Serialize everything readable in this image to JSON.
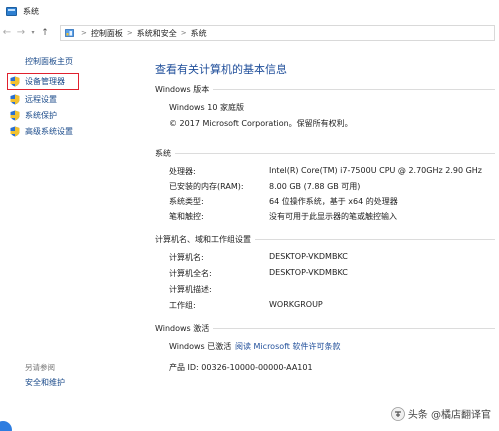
{
  "window": {
    "title": "系统"
  },
  "nav": {
    "back": "←",
    "forward": "→",
    "dropdown": "▾",
    "up": "↑",
    "breadcrumb": [
      "控制面板",
      "系统和安全",
      "系统"
    ],
    "separator": ">"
  },
  "sidebar": {
    "home": "控制面板主页",
    "items": [
      {
        "label": "设备管理器",
        "icon": "shield-icon"
      },
      {
        "label": "远程设置",
        "icon": "shield-icon"
      },
      {
        "label": "系统保护",
        "icon": "shield-icon"
      },
      {
        "label": "高级系统设置",
        "icon": "shield-icon"
      }
    ],
    "see_also": "另请参阅",
    "security": "安全和维护"
  },
  "main": {
    "heading": "查看有关计算机的基本信息",
    "edition": {
      "title": "Windows 版本",
      "name": "Windows 10 家庭版",
      "copyright": "© 2017 Microsoft Corporation。保留所有权利。"
    },
    "system": {
      "title": "系统",
      "rows": [
        {
          "label": "处理器:",
          "value": "Intel(R) Core(TM) i7-7500U CPU @ 2.70GHz   2.90 GHz"
        },
        {
          "label": "已安装的内存(RAM):",
          "value": "8.00 GB (7.88 GB 可用)"
        },
        {
          "label": "系统类型:",
          "value": "64 位操作系统，基于 x64 的处理器"
        },
        {
          "label": "笔和触控:",
          "value": "没有可用于此显示器的笔或触控输入"
        }
      ]
    },
    "computer": {
      "title": "计算机名、域和工作组设置",
      "rows": [
        {
          "label": "计算机名:",
          "value": "DESKTOP-VKDMBKC"
        },
        {
          "label": "计算机全名:",
          "value": "DESKTOP-VKDMBKC"
        },
        {
          "label": "计算机描述:",
          "value": ""
        },
        {
          "label": "工作组:",
          "value": "WORKGROUP"
        }
      ]
    },
    "activation": {
      "title": "Windows 激活",
      "status": "Windows 已激活",
      "license_link": "阅读 Microsoft 软件许可条款",
      "product_id": "产品 ID: 00326-10000-00000-AA101"
    }
  },
  "watermark": {
    "text": "头条 @橘店翻译官"
  },
  "colors": {
    "link": "#1f4e9a",
    "highlight_border": "#e0212e",
    "shield_blue": "#2a6fd0",
    "shield_yellow": "#f2c230"
  }
}
